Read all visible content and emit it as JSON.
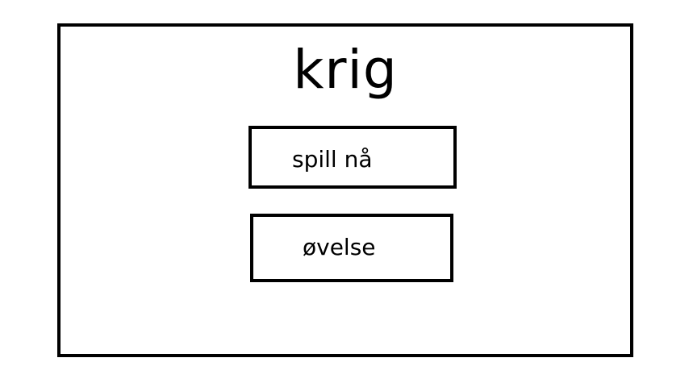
{
  "menu": {
    "title": "krig",
    "buttons": {
      "play_label": "spill nå",
      "practice_label": "øvelse"
    }
  },
  "colors": {
    "background": "#ffffff",
    "border": "#000000",
    "text": "#000000"
  }
}
